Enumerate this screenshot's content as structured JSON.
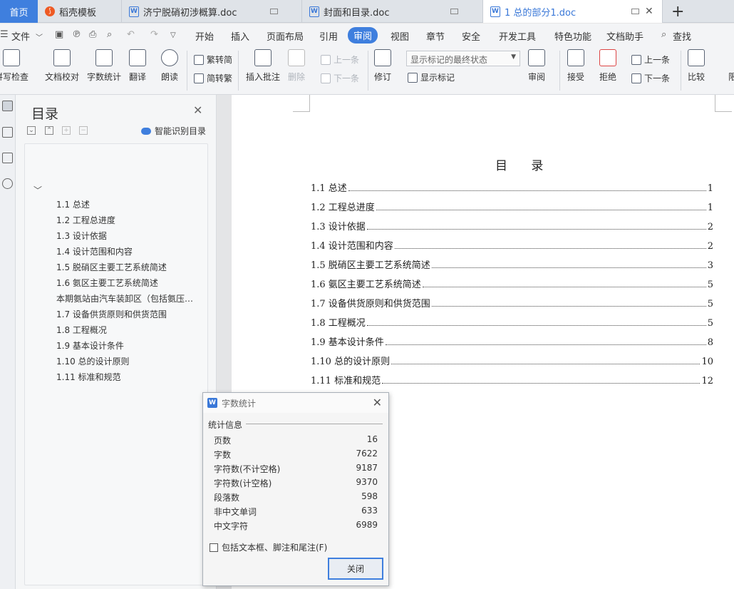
{
  "tabs": [
    {
      "label": "首页"
    },
    {
      "label": "稻壳模板"
    },
    {
      "label": "济宁脱硝初涉概算.doc"
    },
    {
      "label": "封面和目录.doc"
    },
    {
      "label": "1 总的部分1.doc"
    }
  ],
  "menu": {
    "file": "文件",
    "items": [
      "开始",
      "插入",
      "页面布局",
      "引用",
      "审阅",
      "视图",
      "章节",
      "安全",
      "开发工具",
      "特色功能",
      "文档助手",
      "查找"
    ]
  },
  "ribbon": {
    "spell_check": "拼写检查",
    "doc_check": "文档校对",
    "word_count": "字数统计",
    "translate": "翻译",
    "read_aloud": "朗读",
    "trad_to_simp": "繁转简",
    "simp_to_trad": "简转繁",
    "insert_comment": "插入批注",
    "delete": "删除",
    "prev": "上一条",
    "next": "下一条",
    "track": "修订",
    "display_dropdown": "显示标记的最终状态",
    "show_markup": "显示标记",
    "review": "审阅",
    "accept": "接受",
    "reject": "拒绝",
    "prev2": "上一条",
    "next2": "下一条",
    "compare": "比较",
    "limit": "限"
  },
  "nav": {
    "title": "目录",
    "smart": "智能识别目录",
    "items": [
      "1.1 总述",
      "1.2 工程总进度",
      "1.3 设计依据",
      "1.4 设计范围和内容",
      "1.5  脱硝区主要工艺系统简述",
      "1.6  氨区主要工艺系统简述",
      "本期氨站由汽车装卸区（包括氨压缩机…",
      "1.7 设备供货原则和供货范围",
      "1.8  工程概况",
      "1.9  基本设计条件",
      "1.10 总的设计原则",
      "1.11      标准和规范"
    ]
  },
  "toc": {
    "title": "目 录",
    "entries": [
      {
        "text": "1.1 总述 ",
        "page": "1"
      },
      {
        "text": "1.2 工程总进度",
        "page": "1"
      },
      {
        "text": "1.3 设计依据",
        "page": "2"
      },
      {
        "text": "1.4 设计范围和内容",
        "page": "2"
      },
      {
        "text": "1.5  脱硝区主要工艺系统简述",
        "page": "3"
      },
      {
        "text": "1.6 氨区主要工艺系统简述",
        "page": "5"
      },
      {
        "text": "1.7 设备供货原则和供货范围",
        "page": "5"
      },
      {
        "text": "1.8  工程概况",
        "page": "5"
      },
      {
        "text": "1.9  基本设计条件",
        "page": "8"
      },
      {
        "text": "1.10 总的设计原则",
        "page": "10"
      },
      {
        "text": "1.11    标准和规范",
        "page": "12"
      }
    ]
  },
  "dialog": {
    "title": "字数统计",
    "section": "统计信息",
    "stats": [
      {
        "label": "页数",
        "value": "16"
      },
      {
        "label": "字数",
        "value": "7622"
      },
      {
        "label": "字符数(不计空格)",
        "value": "9187"
      },
      {
        "label": "字符数(计空格)",
        "value": "9370"
      },
      {
        "label": "段落数",
        "value": "598"
      },
      {
        "label": "非中文单词",
        "value": "633"
      },
      {
        "label": "中文字符",
        "value": "6989"
      }
    ],
    "checkbox": "包括文本框、脚注和尾注(F)",
    "close": "关闭"
  },
  "colors": {
    "accent": "#3f7fde"
  }
}
